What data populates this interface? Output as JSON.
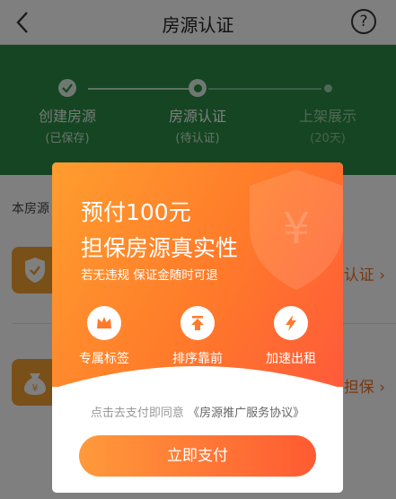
{
  "header": {
    "title": "房源认证",
    "help_glyph": "?"
  },
  "steps": [
    {
      "title": "创建房源",
      "subtitle": "(已保存)",
      "state": "done"
    },
    {
      "title": "房源认证",
      "subtitle": "(待认证)",
      "state": "current"
    },
    {
      "title": "上架展示",
      "subtitle": "(20天)",
      "state": "pending"
    }
  ],
  "content": {
    "section_label": "本房源",
    "items": [
      {
        "icon": "shield-check-icon",
        "action_label": "认证"
      },
      {
        "icon": "money-bag-icon",
        "action_label": "担保"
      }
    ]
  },
  "modal": {
    "headline_line1": "预付100元",
    "headline_line2": "担保房源真实性",
    "subline": "若无违规 保证金随时可退",
    "deco_symbol": "¥",
    "features": [
      {
        "icon": "crown-icon",
        "label": "专属标签"
      },
      {
        "icon": "up-arrow-icon",
        "label": "排序靠前"
      },
      {
        "icon": "lightning-icon",
        "label": "加速出租"
      }
    ],
    "agreement_prefix": "点击去支付即同意",
    "agreement_link": "《房源推广服务协议》",
    "pay_button": "立即支付"
  },
  "colors": {
    "brand_green": "#2a8a45",
    "accent_orange": "#ff7a2a"
  }
}
